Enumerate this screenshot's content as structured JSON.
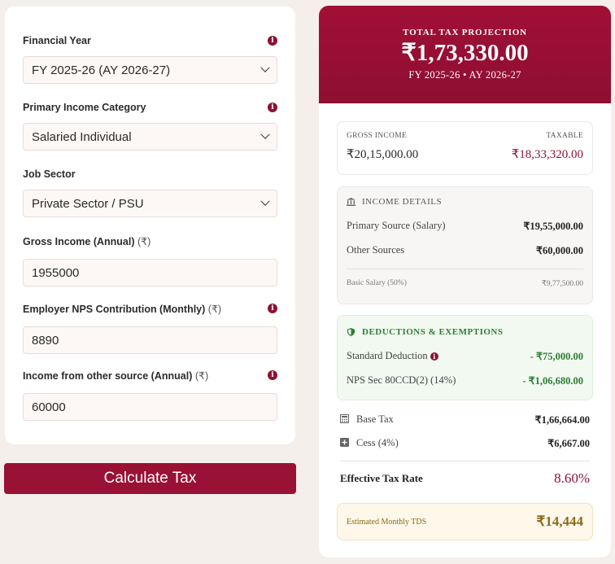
{
  "form": {
    "financial_year": {
      "label": "Financial Year",
      "value": "FY 2025-26 (AY 2026-27)"
    },
    "income_category": {
      "label": "Primary Income Category",
      "value": "Salaried Individual"
    },
    "job_sector": {
      "label": "Job Sector",
      "value": "Private Sector / PSU"
    },
    "gross_income": {
      "label": "Gross Income (Annual)",
      "unit": "(₹)",
      "value": "1955000"
    },
    "employer_nps": {
      "label": "Employer NPS Contribution (Monthly)",
      "unit": "(₹)",
      "value": "8890"
    },
    "other_income": {
      "label": "Income from other source (Annual)",
      "unit": "(₹)",
      "value": "60000"
    },
    "calculate_label": "Calculate Tax"
  },
  "result": {
    "hero_kicker": "TOTAL TAX PROJECTION",
    "hero_amount": "₹1,73,330.00",
    "hero_sub": "FY 2025-26 • AY 2026-27",
    "gross_caption": "GROSS INCOME",
    "gross_value": "₹20,15,000.00",
    "taxable_caption": "TAXABLE",
    "taxable_value": "₹18,33,320.00",
    "income_title": "INCOME DETAILS",
    "primary_label": "Primary Source (Salary)",
    "primary_value": "₹19,55,000.00",
    "other_label": "Other Sources",
    "other_value": "₹60,000.00",
    "basic_label": "Basic Salary (50%)",
    "basic_value": "₹9,77,500.00",
    "deduct_title": "DEDUCTIONS & EXEMPTIONS",
    "std_label": "Standard Deduction",
    "std_value": "- ₹75,000.00",
    "nps_label": "NPS Sec 80CCD(2) (14%)",
    "nps_value": "- ₹1,06,680.00",
    "base_tax_label": "Base Tax",
    "base_tax_value": "₹1,66,664.00",
    "cess_label": "Cess (4%)",
    "cess_value": "₹6,667.00",
    "eff_label": "Effective Tax Rate",
    "eff_value": "8.60%",
    "tds_label": "Estimated Monthly TDS",
    "tds_value": "₹14,444"
  },
  "colors": {
    "accent": "#9a1136",
    "green": "#2e7d32",
    "gold": "#8a6a1b"
  }
}
